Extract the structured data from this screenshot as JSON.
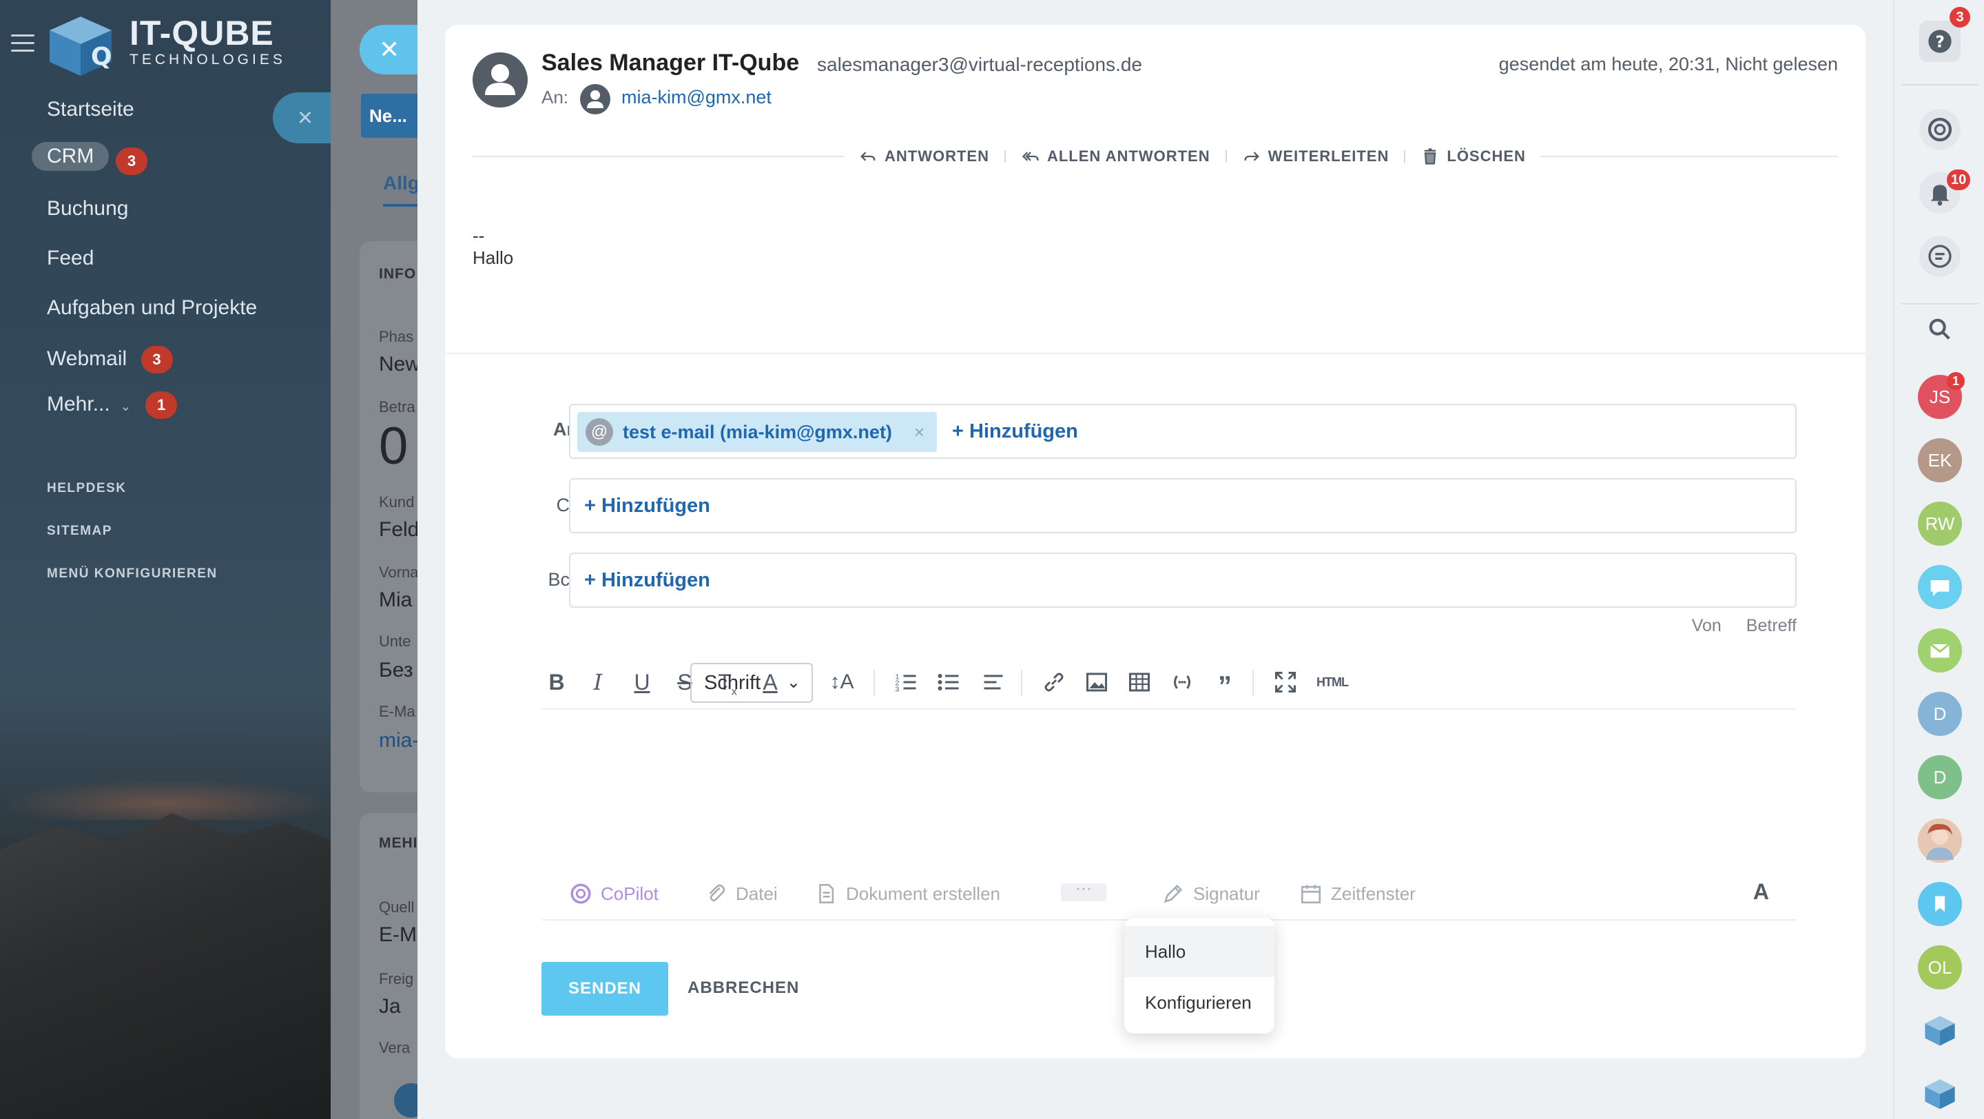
{
  "sidebar": {
    "logo_main": "IT-QUBE",
    "logo_sub": "TECHNOLOGIES",
    "items": [
      {
        "label": "Startseite"
      },
      {
        "label": "CRM",
        "badge": "3"
      },
      {
        "label": "Buchung"
      },
      {
        "label": "Feed"
      },
      {
        "label": "Aufgaben und Projekte"
      },
      {
        "label": "Webmail",
        "badge": "3"
      },
      {
        "label": "Mehr...",
        "caret": "⌄",
        "badge": "1"
      }
    ],
    "small_links": [
      "HELPDESK",
      "SITEMAP",
      "MENÜ KONFIGURIEREN"
    ]
  },
  "mid_panel": {
    "button_label": "Ne...",
    "tab_label": "Allg",
    "section_info": "INFO",
    "section_more": "MEHI",
    "fields": [
      {
        "label": "Phas",
        "value": "New"
      },
      {
        "label": "Betra",
        "value": "0"
      },
      {
        "label": "Kund",
        "value": "Feld"
      },
      {
        "label": "Vorna",
        "value": "Mia"
      },
      {
        "label": "Unte",
        "value": "Без"
      },
      {
        "label": "E-Ma",
        "value": "mia-"
      },
      {
        "label": "Quell",
        "value": "E-M"
      },
      {
        "label": "Freig",
        "value": "Ja"
      },
      {
        "label": "Vera",
        "value": ""
      }
    ]
  },
  "mail": {
    "sender_name": "Sales Manager IT-Qube",
    "sender_email": "salesmanager3@virtual-receptions.de",
    "status": "gesendet am heute, 20:31, Nicht gelesen",
    "to_label": "An:",
    "to_email": "mia-kim@gmx.net",
    "actions": [
      "ANTWORTEN",
      "ALLEN ANTWORTEN",
      "WEITERLEITEN",
      "LÖSCHEN"
    ],
    "body_sig_sep": "--",
    "body_text": "Hallo"
  },
  "reply": {
    "to_label": "An:",
    "cc_label": "Cc:",
    "bcc_label": "Bcc:",
    "recipient_chip": "test e-mail (mia-kim@gmx.net)",
    "chip_at": "@",
    "chip_remove": "×",
    "add_label": "+ Hinzufügen",
    "from_label": "Von",
    "subject_label": "Betreff",
    "font_select": "Schrift",
    "html_label": "HTML",
    "tools": {
      "copilot": "CoPilot",
      "file": "Datei",
      "create_doc": "Dokument erstellen",
      "more": "···",
      "signature": "Signatur",
      "timeslot": "Zeitfenster",
      "text_format": "A"
    },
    "send_label": "SENDEN",
    "cancel_label": "ABBRECHEN",
    "signature_menu": [
      "Hallo",
      "Konfigurieren"
    ]
  },
  "rail": {
    "help_badge": "3",
    "bell_badge": "10",
    "avatar_js_badge": "1",
    "avatars": [
      {
        "initials": "JS",
        "color": "#e0525f"
      },
      {
        "initials": "EK",
        "color": "#b69889"
      },
      {
        "initials": "RW",
        "color": "#9fcb6a"
      },
      {
        "initials": "D",
        "color": "#86b4d6"
      },
      {
        "initials": "D",
        "color": "#7fbf8a"
      },
      {
        "initials": "OL",
        "color": "#a3c95c"
      }
    ]
  },
  "colors": {
    "accent": "#2067b0",
    "send_button": "#5ec7ef",
    "badge": "#c0392b"
  }
}
